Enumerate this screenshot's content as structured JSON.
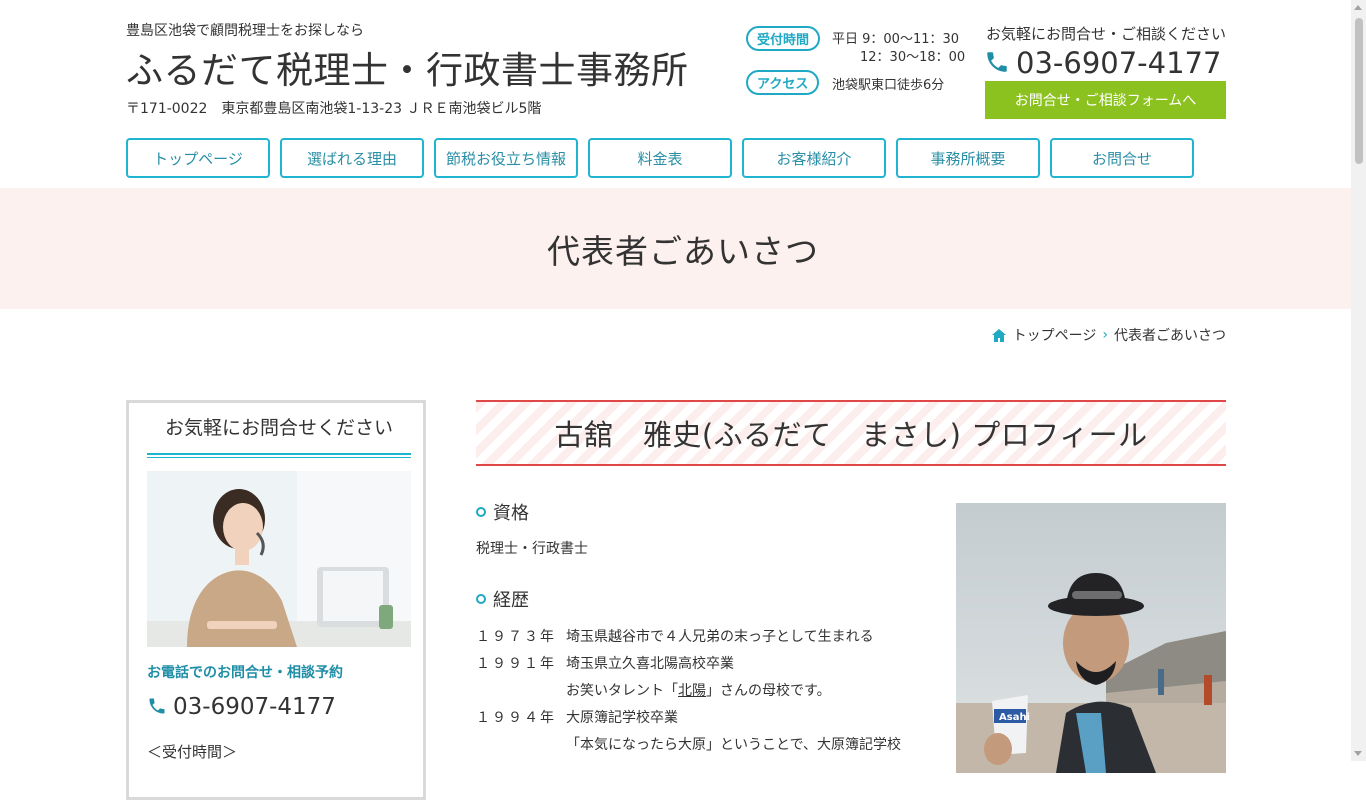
{
  "header": {
    "tagline": "豊島区池袋で顧問税理士をお探しなら",
    "site_title": "ふるだて税理士・行政書士事務所",
    "address": "〒171-0022　東京都豊島区南池袋1-13-23 ＪＲＥ南池袋ビル5階",
    "hours_badge": "受付時間",
    "hours_line1": "平日  9：00〜11：30",
    "hours_line2": "12：30〜18：00",
    "access_badge": "アクセス",
    "access_text": "池袋駅東口徒歩6分",
    "contact_label": "お気軽にお問合せ・ご相談ください",
    "phone": "03-6907-4177",
    "form_button": "お問合せ・ご相談フォームへ"
  },
  "nav": {
    "items": [
      {
        "label": "トップページ"
      },
      {
        "label": "選ばれる理由"
      },
      {
        "label": "節税お役立ち情報"
      },
      {
        "label": "料金表"
      },
      {
        "label": "お客様紹介"
      },
      {
        "label": "事務所概要"
      },
      {
        "label": "お問合せ"
      }
    ]
  },
  "page": {
    "title": "代表者ごあいさつ"
  },
  "breadcrumb": {
    "home": "トップページ",
    "current": "代表者ごあいさつ"
  },
  "sidebar": {
    "title": "お気軽にお問合せください",
    "tel_label": "お電話でのお問合せ・相談予約",
    "phone": "03-6907-4177",
    "hours_label": "＜受付時間＞"
  },
  "profile": {
    "heading": "古舘　雅史(ふるだて　まさし) プロフィール",
    "qual_title": "資格",
    "qual_text": "税理士・行政書士",
    "career_title": "経歴",
    "history": [
      {
        "year": "１９７３年",
        "text": "埼玉県越谷市で４人兄弟の末っ子として生まれる"
      },
      {
        "year": "１９９１年",
        "text": "埼玉県立久喜北陽高校卒業"
      },
      {
        "year": "",
        "text_pre": "お笑いタレント「",
        "text_link": "北陽",
        "text_post": "」さんの母校です。"
      },
      {
        "year": "１９９４年",
        "text": "大原簿記学校卒業"
      },
      {
        "year": "",
        "text": "「本気になったら大原」ということで、大原簿記学校"
      }
    ]
  },
  "colors": {
    "accent": "#1fb4cf",
    "green_button": "#8cc21f",
    "band_bg": "#fdf1ef",
    "heading_border": "#e04848"
  }
}
